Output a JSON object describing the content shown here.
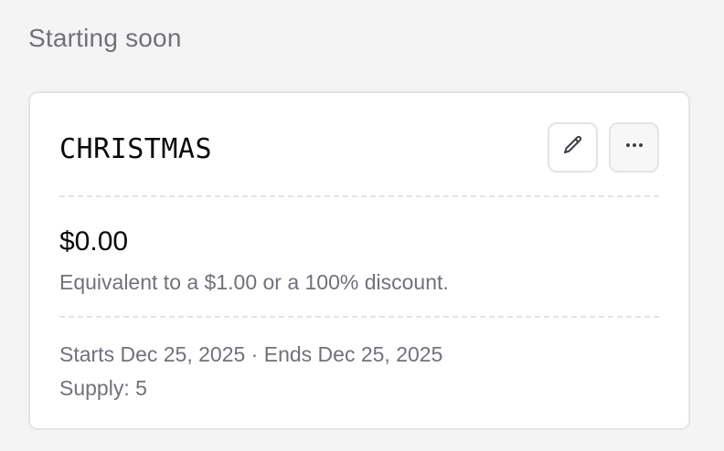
{
  "section": {
    "title": "Starting soon"
  },
  "discount": {
    "code": "CHRISTMAS",
    "price": "$0.00",
    "equivalent_text": "Equivalent to a $1.00 or a 100% discount.",
    "dates_text": "Starts Dec 25, 2025 · Ends Dec 25, 2025",
    "supply_text": "Supply: 5"
  },
  "actions": {
    "edit_icon": "pencil-icon",
    "more_icon": "ellipsis-icon"
  },
  "colors": {
    "muted_text": "#71717a",
    "primary_text": "#09090b",
    "border": "#e4e4e7",
    "background": "#f4f4f5"
  }
}
